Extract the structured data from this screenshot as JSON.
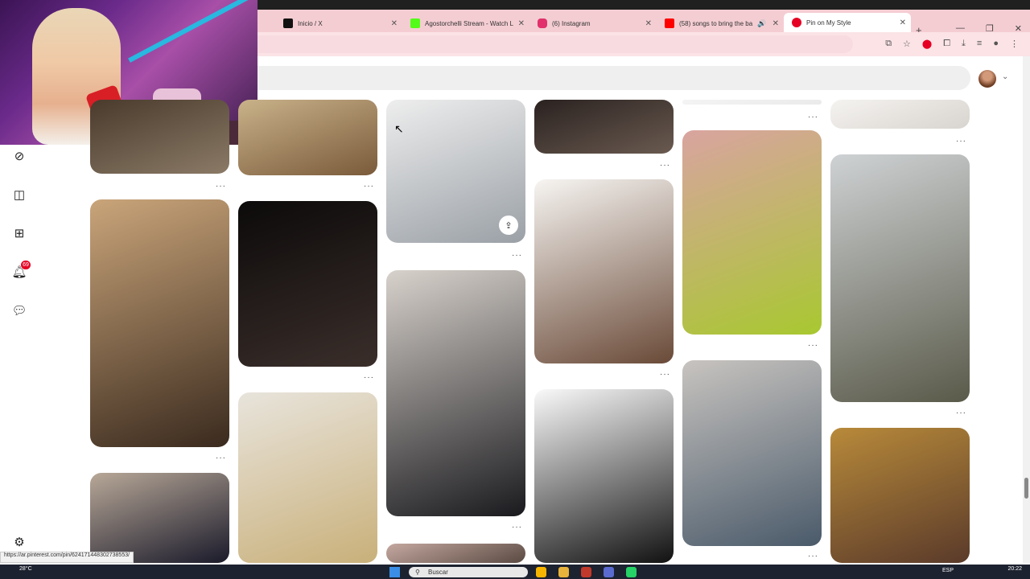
{
  "browser": {
    "tabs": [
      {
        "label": "Inicio / X",
        "color": "#111111",
        "active": false
      },
      {
        "label": "Agostorchelli Stream - Watch L",
        "color": "#53fc18",
        "active": false
      },
      {
        "label": "(6) Instagram",
        "color": "#e1306c",
        "active": false
      },
      {
        "label": "(58) songs to bring the ba",
        "color": "#ff0000",
        "active": false
      },
      {
        "label": "Pin on My Style",
        "color": "#e60023",
        "active": true
      }
    ],
    "new_tab_label": "+",
    "status_url": "https://ar.pinterest.com/pin/624171448302738553/"
  },
  "sidebar": {
    "icons": [
      "explore-icon",
      "boards-icon",
      "create-icon",
      "notifications-icon",
      "messages-icon",
      "settings-icon"
    ],
    "notifications_badge": "69"
  },
  "pins": [
    {
      "name": "pin-living-room",
      "colors": [
        "#4a3a2c",
        "#8a7a66"
      ]
    },
    {
      "name": "pin-food-boots",
      "colors": [
        "#c9b28a",
        "#7a5a3a"
      ]
    },
    {
      "name": "pin-grey-outfit",
      "colors": [
        "#eeeeee",
        "#9aa0a6"
      ]
    },
    {
      "name": "pin-black-dress-heels",
      "colors": [
        "#2a2220",
        "#6a5a50"
      ]
    },
    {
      "name": "pin-dark-top",
      "colors": [
        "#f4f4f4",
        "#eaeaea"
      ]
    },
    {
      "name": "pin-building-top",
      "colors": [
        "#f5f3f0",
        "#d8d4cf"
      ]
    },
    {
      "name": "pin-leopard-dress",
      "colors": [
        "#caa57a",
        "#3a2a1e"
      ]
    },
    {
      "name": "pin-car-tights",
      "colors": [
        "#0c0a0a",
        "#3a2e2a"
      ]
    },
    {
      "name": "pin-brown-outfit-flatlay",
      "colors": [
        "#f7f5f2",
        "#6a4a38"
      ]
    },
    {
      "name": "pin-green-top",
      "colors": [
        "#d9a4a0",
        "#a8c830"
      ]
    },
    {
      "name": "pin-hoodie-duo",
      "colors": [
        "#cfd2d4",
        "#5a5a4a"
      ]
    },
    {
      "name": "pin-street-mesh-top",
      "colors": [
        "#b8a898",
        "#1a1a2a"
      ]
    },
    {
      "name": "pin-blonde-portrait",
      "colors": [
        "#e8e4dc",
        "#c9b07a"
      ]
    },
    {
      "name": "pin-fur-jacket",
      "colors": [
        "#d8d2cc",
        "#1a1a1e"
      ]
    },
    {
      "name": "pin-black-dress-flatlay",
      "colors": [
        "#fafafa",
        "#111111"
      ]
    },
    {
      "name": "pin-baggy-jeans",
      "colors": [
        "#c8c4c0",
        "#4a5a6a"
      ]
    },
    {
      "name": "pin-gold-frame",
      "colors": [
        "#b88a3a",
        "#5a3a2a"
      ]
    },
    {
      "name": "pin-partial-bottom",
      "colors": [
        "#c4a8a0",
        "#5a4a42"
      ]
    }
  ],
  "taskbar": {
    "weather": "28°C",
    "search_placeholder": "Buscar",
    "language": "ESP",
    "time": "20:22"
  }
}
